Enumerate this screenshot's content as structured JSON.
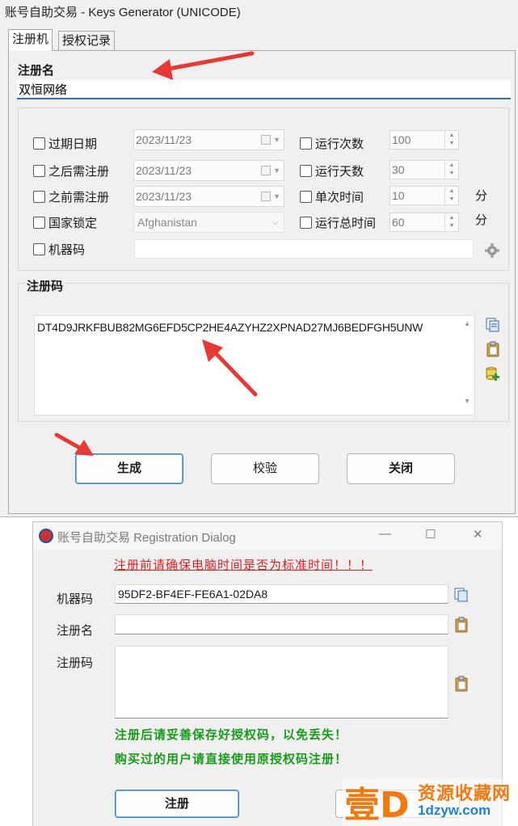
{
  "keygen": {
    "title": "账号自助交易  - Keys Generator (UNICODE)",
    "tabs": [
      "注册机",
      "授权记录"
    ],
    "regname_label": "注册名",
    "regname_value": "双恒网络",
    "options": {
      "expire_date": {
        "label": "过期日期",
        "value": "2023/11/23"
      },
      "after_reg": {
        "label": "之后需注册",
        "value": "2023/11/23"
      },
      "before_reg": {
        "label": "之前需注册",
        "value": "2023/11/23"
      },
      "country_lock": {
        "label": "国家锁定",
        "value": "Afghanistan"
      },
      "machine_code": {
        "label": "机器码",
        "value": ""
      },
      "run_count": {
        "label": "运行次数",
        "value": "100"
      },
      "run_days": {
        "label": "运行天数",
        "value": "30"
      },
      "single_time": {
        "label": "单次时间",
        "value": "10",
        "unit": "分"
      },
      "total_time": {
        "label": "运行总时间",
        "value": "60",
        "unit": "分"
      }
    },
    "code_label": "注册码",
    "code_value": "DT4D9JRKFBUB82MG6EFD5CP2HE4AZYHZ2XPNAD27MJ6BEDFGH5UNW",
    "buttons": {
      "generate": "生成",
      "verify": "校验",
      "close": "关闭"
    }
  },
  "dialog": {
    "title": "账号自助交易  Registration Dialog",
    "warning_top": "注册前请确保电脑时间是否为标准时间！！！",
    "machine_label": "机器码",
    "machine_value": "95DF2-BF4EF-FE6A1-02DA8",
    "name_label": "注册名",
    "name_value": "",
    "code_label": "注册码",
    "code_value": "",
    "notice1": "注册后请妥善保存好授权码，以免丢失！",
    "notice2": "购买过的用户请直接使用原授权码注册！",
    "register_button": "注册",
    "window_controls": {
      "minimize": "—",
      "maximize": "☐",
      "close": "✕"
    }
  },
  "watermark": {
    "mark": "壹D",
    "cn": "资源收藏网",
    "url": "1dzyw.com"
  },
  "colors": {
    "accent": "#2f6fbf",
    "warning": "#e02020",
    "notice": "#1a9a1a",
    "arrow": "#e53935"
  }
}
